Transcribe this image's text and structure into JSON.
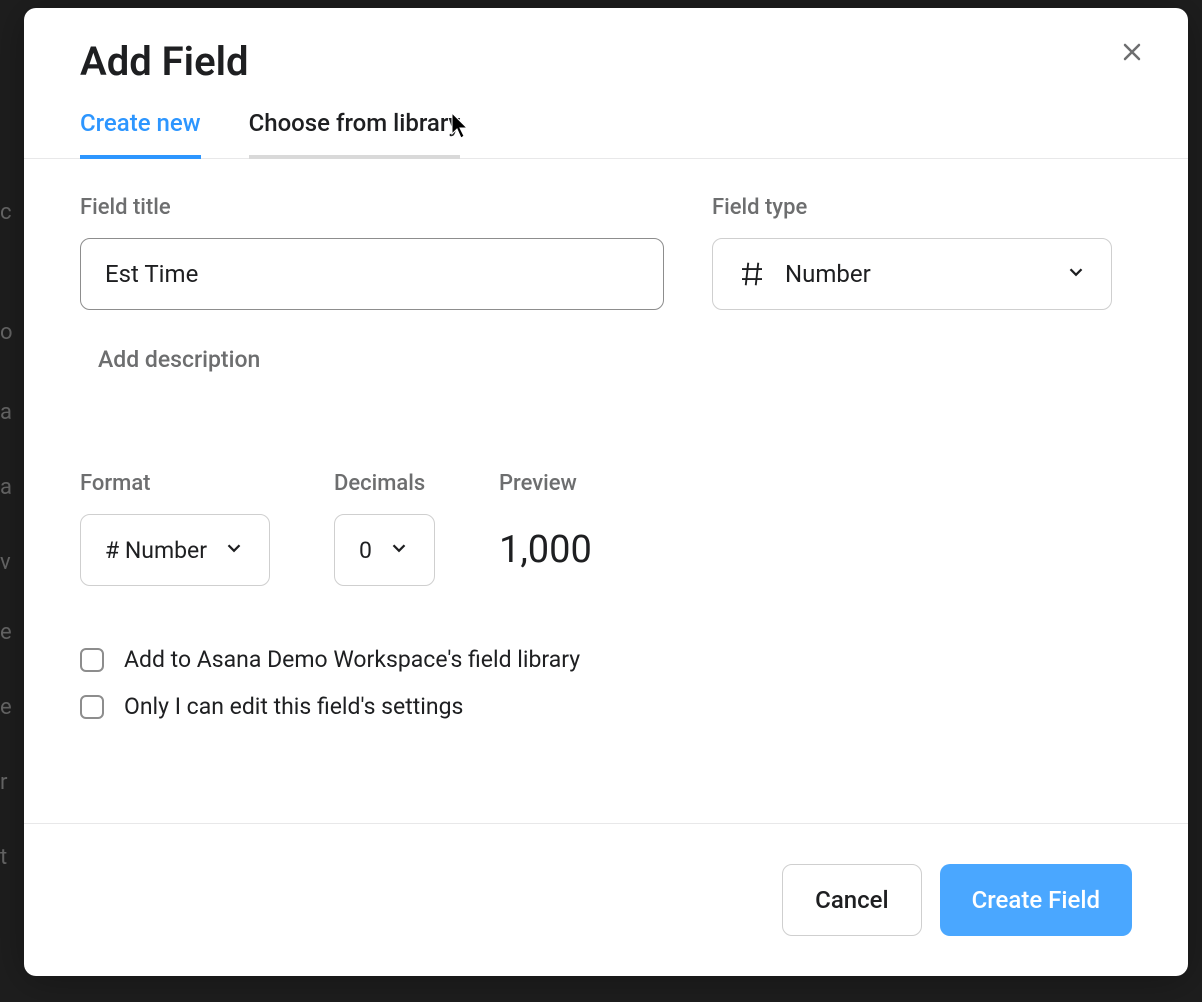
{
  "modal": {
    "title": "Add Field",
    "tabs": {
      "create_new": "Create new",
      "choose_library": "Choose from library"
    },
    "field_title": {
      "label": "Field title",
      "value": "Est Time"
    },
    "field_type": {
      "label": "Field type",
      "value": "Number"
    },
    "add_description": "Add description",
    "format": {
      "label": "Format",
      "value": "# Number"
    },
    "decimals": {
      "label": "Decimals",
      "value": "0"
    },
    "preview": {
      "label": "Preview",
      "value": "1,000"
    },
    "checkboxes": {
      "library": "Add to Asana Demo Workspace's field library",
      "only_edit": "Only I can edit this field's settings"
    },
    "buttons": {
      "cancel": "Cancel",
      "create": "Create Field"
    }
  }
}
